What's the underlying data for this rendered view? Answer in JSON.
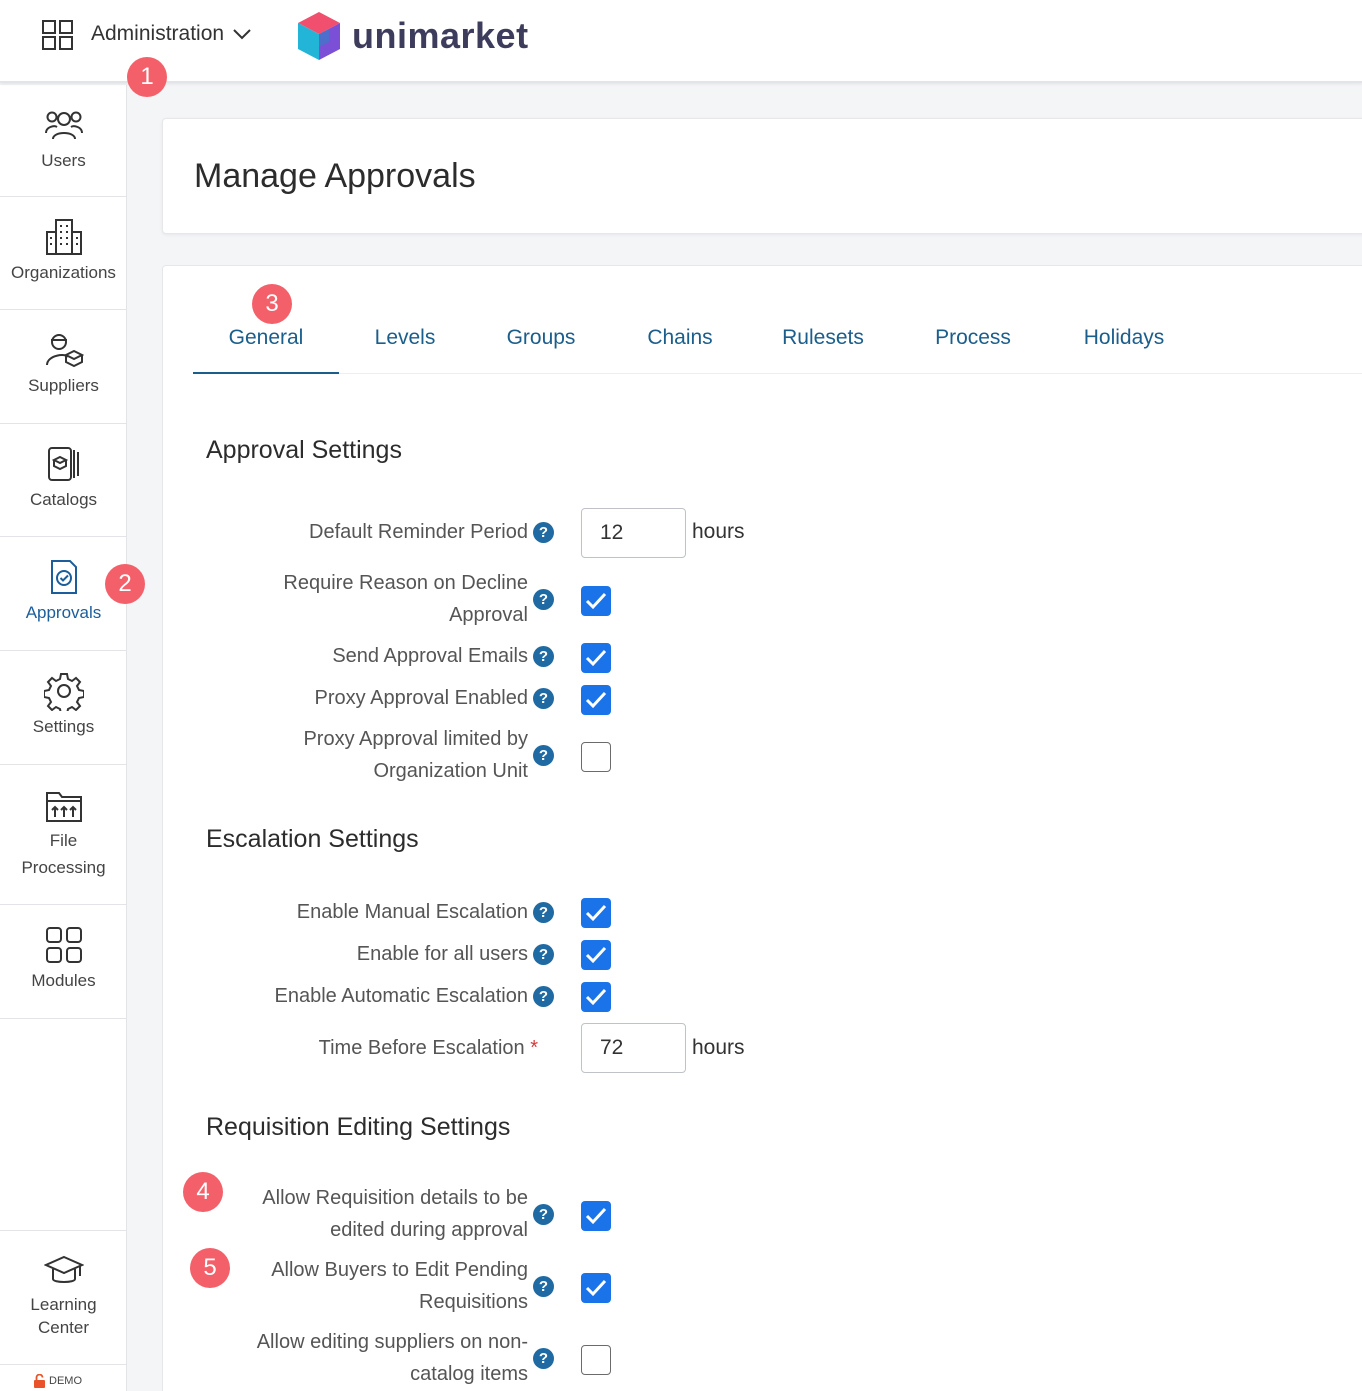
{
  "topbar": {
    "menu_label": "Administration",
    "brand": "unimarket",
    "icons": {
      "apps": "grid-icon",
      "chevron": "chevron-down-icon"
    }
  },
  "sidebar": {
    "items": [
      {
        "label": "Users",
        "icon": "users-icon"
      },
      {
        "label": "Organizations",
        "icon": "building-icon"
      },
      {
        "label": "Suppliers",
        "icon": "supplier-icon"
      },
      {
        "label": "Catalogs",
        "icon": "catalog-icon"
      },
      {
        "label": "Approvals",
        "icon": "approvals-icon"
      },
      {
        "label": "Settings",
        "icon": "gear-icon"
      },
      {
        "label_line1": "File",
        "label_line2": "Processing",
        "icon": "file-processing-icon"
      },
      {
        "label": "Modules",
        "icon": "modules-icon"
      }
    ],
    "learning": {
      "label_line1": "Learning",
      "label_line2": "Center",
      "icon": "graduation-cap-icon"
    },
    "demo_badge": "DEMO"
  },
  "page": {
    "title": "Manage Approvals"
  },
  "tabs": [
    {
      "label": "General",
      "active": true
    },
    {
      "label": "Levels"
    },
    {
      "label": "Groups"
    },
    {
      "label": "Chains"
    },
    {
      "label": "Rulesets"
    },
    {
      "label": "Process"
    },
    {
      "label": "Holidays"
    }
  ],
  "approval_settings": {
    "title": "Approval Settings",
    "reminder_label": "Default Reminder Period",
    "reminder_value": "12",
    "reminder_unit": "hours",
    "decline_line1": "Require Reason on Decline",
    "decline_line2": "Approval",
    "decline_checked": true,
    "emails_label": "Send Approval Emails",
    "emails_checked": true,
    "proxy_label": "Proxy Approval Enabled",
    "proxy_checked": true,
    "proxy_limited_line1": "Proxy Approval limited by",
    "proxy_limited_line2": "Organization Unit",
    "proxy_limited_checked": false
  },
  "escalation_settings": {
    "title": "Escalation Settings",
    "manual_label": "Enable Manual Escalation",
    "manual_checked": true,
    "all_users_label": "Enable for all users",
    "all_users_checked": true,
    "automatic_label": "Enable Automatic Escalation",
    "automatic_checked": true,
    "time_label": "Time Before Escalation",
    "required_mark": "*",
    "time_value": "72",
    "time_unit": "hours"
  },
  "requisition_settings": {
    "title": "Requisition Editing Settings",
    "details_line1": "Allow Requisition details to be",
    "details_line2": "edited during approval",
    "details_checked": true,
    "buyers_line1": "Allow Buyers to Edit Pending",
    "buyers_line2": "Requisitions",
    "buyers_checked": true,
    "suppliers_line1": "Allow editing suppliers on non-",
    "suppliers_line2": "catalog items",
    "suppliers_checked": false
  },
  "callouts": [
    "1",
    "2",
    "3",
    "4",
    "5"
  ],
  "colors": {
    "accent": "#1a73e8",
    "tab": "#1b5e8c",
    "help": "#1f6aa3",
    "callout": "#f4606a"
  }
}
